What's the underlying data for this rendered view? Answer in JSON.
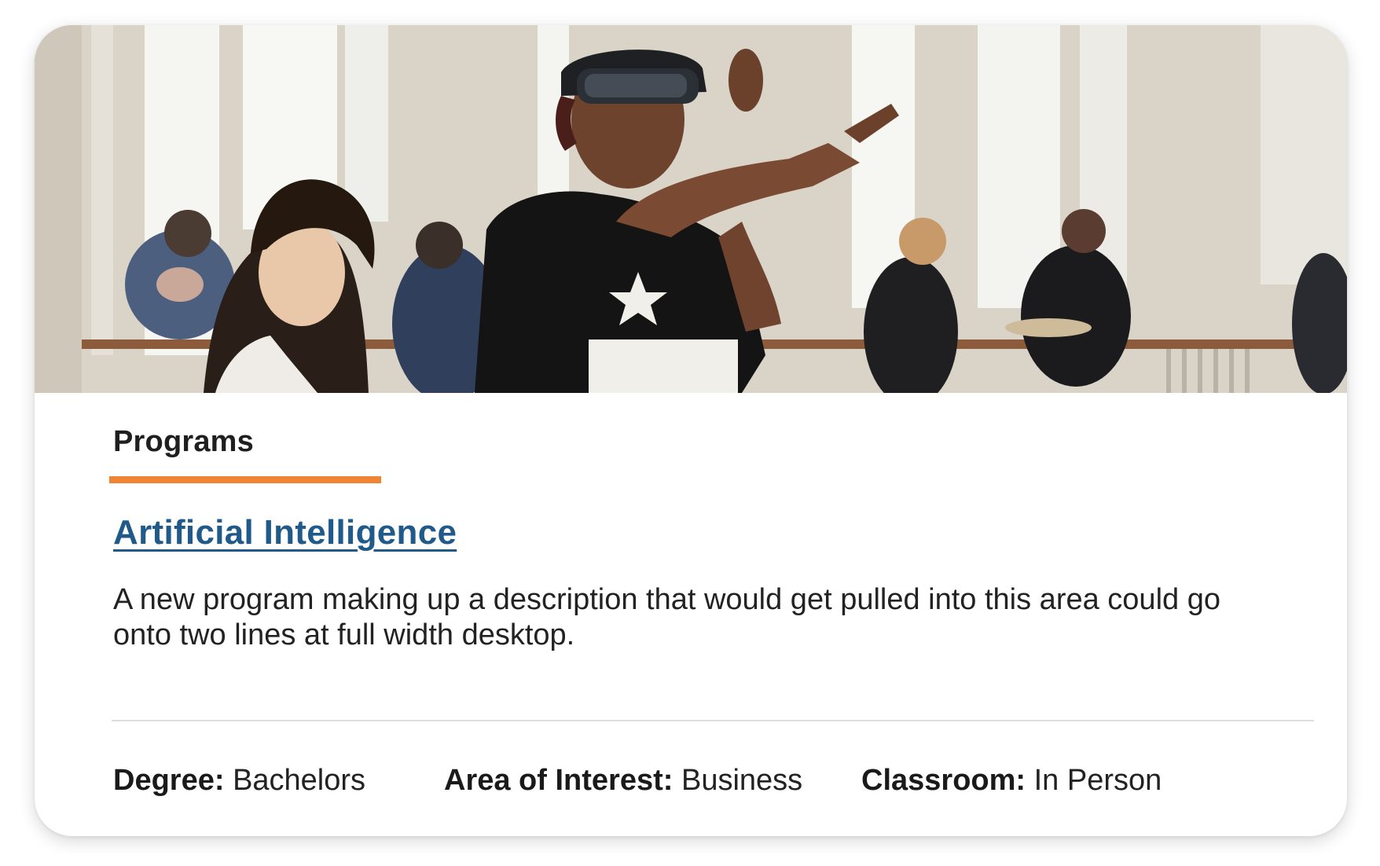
{
  "hero": {
    "image_description": "Students using a mixed-reality headset in a bright atrium",
    "icon": "photo"
  },
  "card": {
    "category": "Programs",
    "title": "Artificial Intelligence",
    "description": "A new program making up a description that would get pulled into this area could go onto two lines at full width desktop."
  },
  "meta": {
    "degree_label": "Degree:",
    "degree_value": "Bachelors",
    "area_label": "Area of Interest:",
    "area_value": "Business",
    "classroom_label": "Classroom:",
    "classroom_value": "In Person"
  },
  "colors": {
    "accent": "#ef8534",
    "link": "#1f5a8b",
    "text": "#222222",
    "divider": "#dcdcdc"
  }
}
